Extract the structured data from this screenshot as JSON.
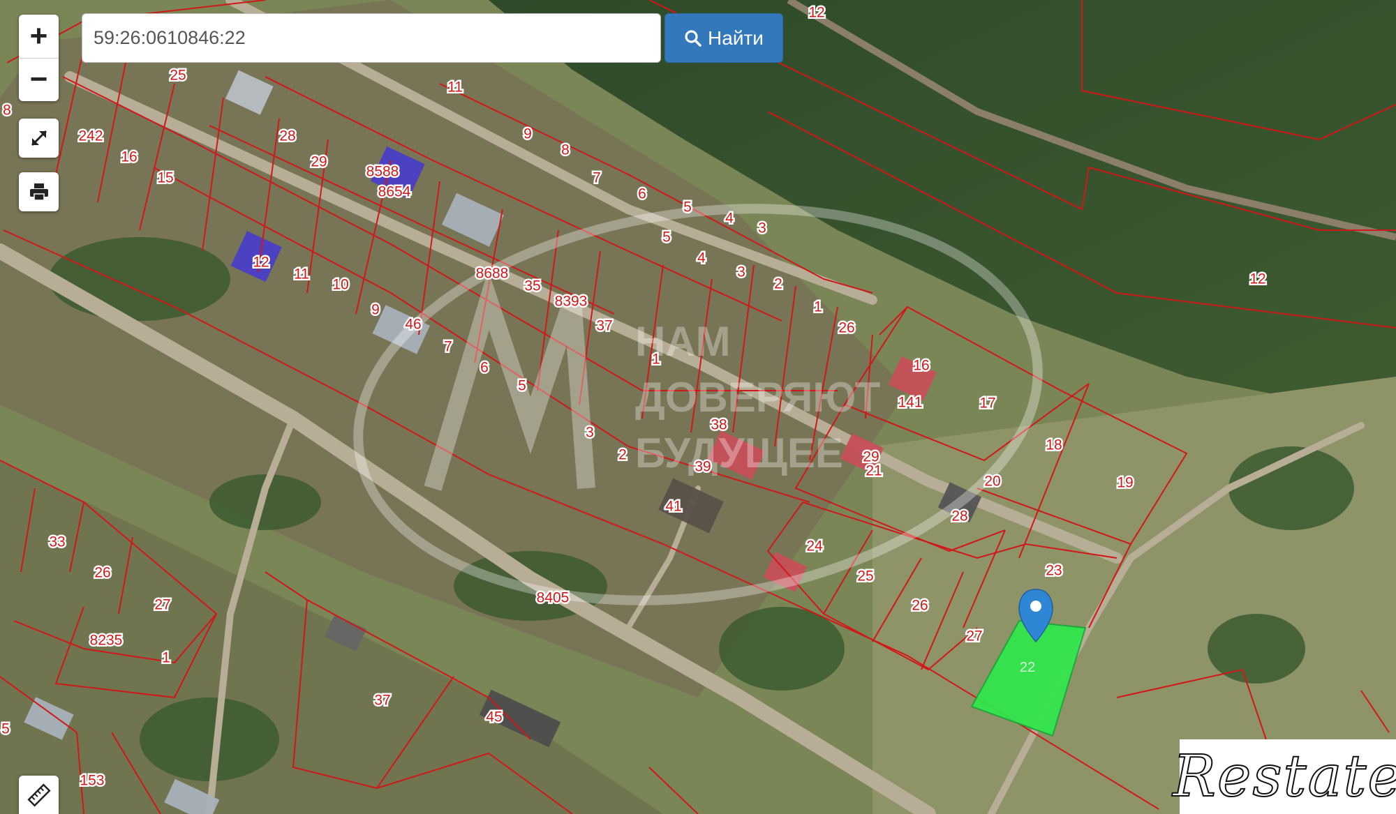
{
  "search": {
    "value": "59:26:0610846:22",
    "button_label": "Найти",
    "button_icon": "search-icon"
  },
  "controls": {
    "zoom_in": "+",
    "zoom_out": "−",
    "fullscreen_icon": "expand-icon",
    "print_icon": "printer-icon",
    "ruler_icon": "ruler-icon"
  },
  "colors": {
    "parcel_border": "#d01818",
    "selected_parcel": "#2ee84a",
    "marker": "#2f86d4"
  },
  "watermark": {
    "lines": [
      "НАМ",
      "ДОВЕРЯЮТ",
      "БУДУЩЕЕ"
    ]
  },
  "logo": {
    "text": "Restate"
  },
  "selected_parcel": {
    "number": "22"
  },
  "parcel_labels": [
    "12",
    "8",
    "25",
    "242",
    "16",
    "15",
    "28",
    "29",
    "8588",
    "8654",
    "11",
    "9",
    "8",
    "7",
    "6",
    "5",
    "4",
    "3",
    "12",
    "11",
    "10",
    "9",
    "46",
    "8688",
    "35",
    "8393",
    "37",
    "5",
    "4",
    "3",
    "2",
    "1",
    "26",
    "7",
    "6",
    "5",
    "1",
    "16",
    "141",
    "17",
    "18",
    "19",
    "20",
    "3",
    "2",
    "38",
    "39",
    "41",
    "29",
    "21",
    "28",
    "24",
    "25",
    "26",
    "27",
    "23",
    "33",
    "26",
    "27",
    "8235",
    "1",
    "8405",
    "37",
    "45",
    "5",
    "153",
    "12"
  ]
}
